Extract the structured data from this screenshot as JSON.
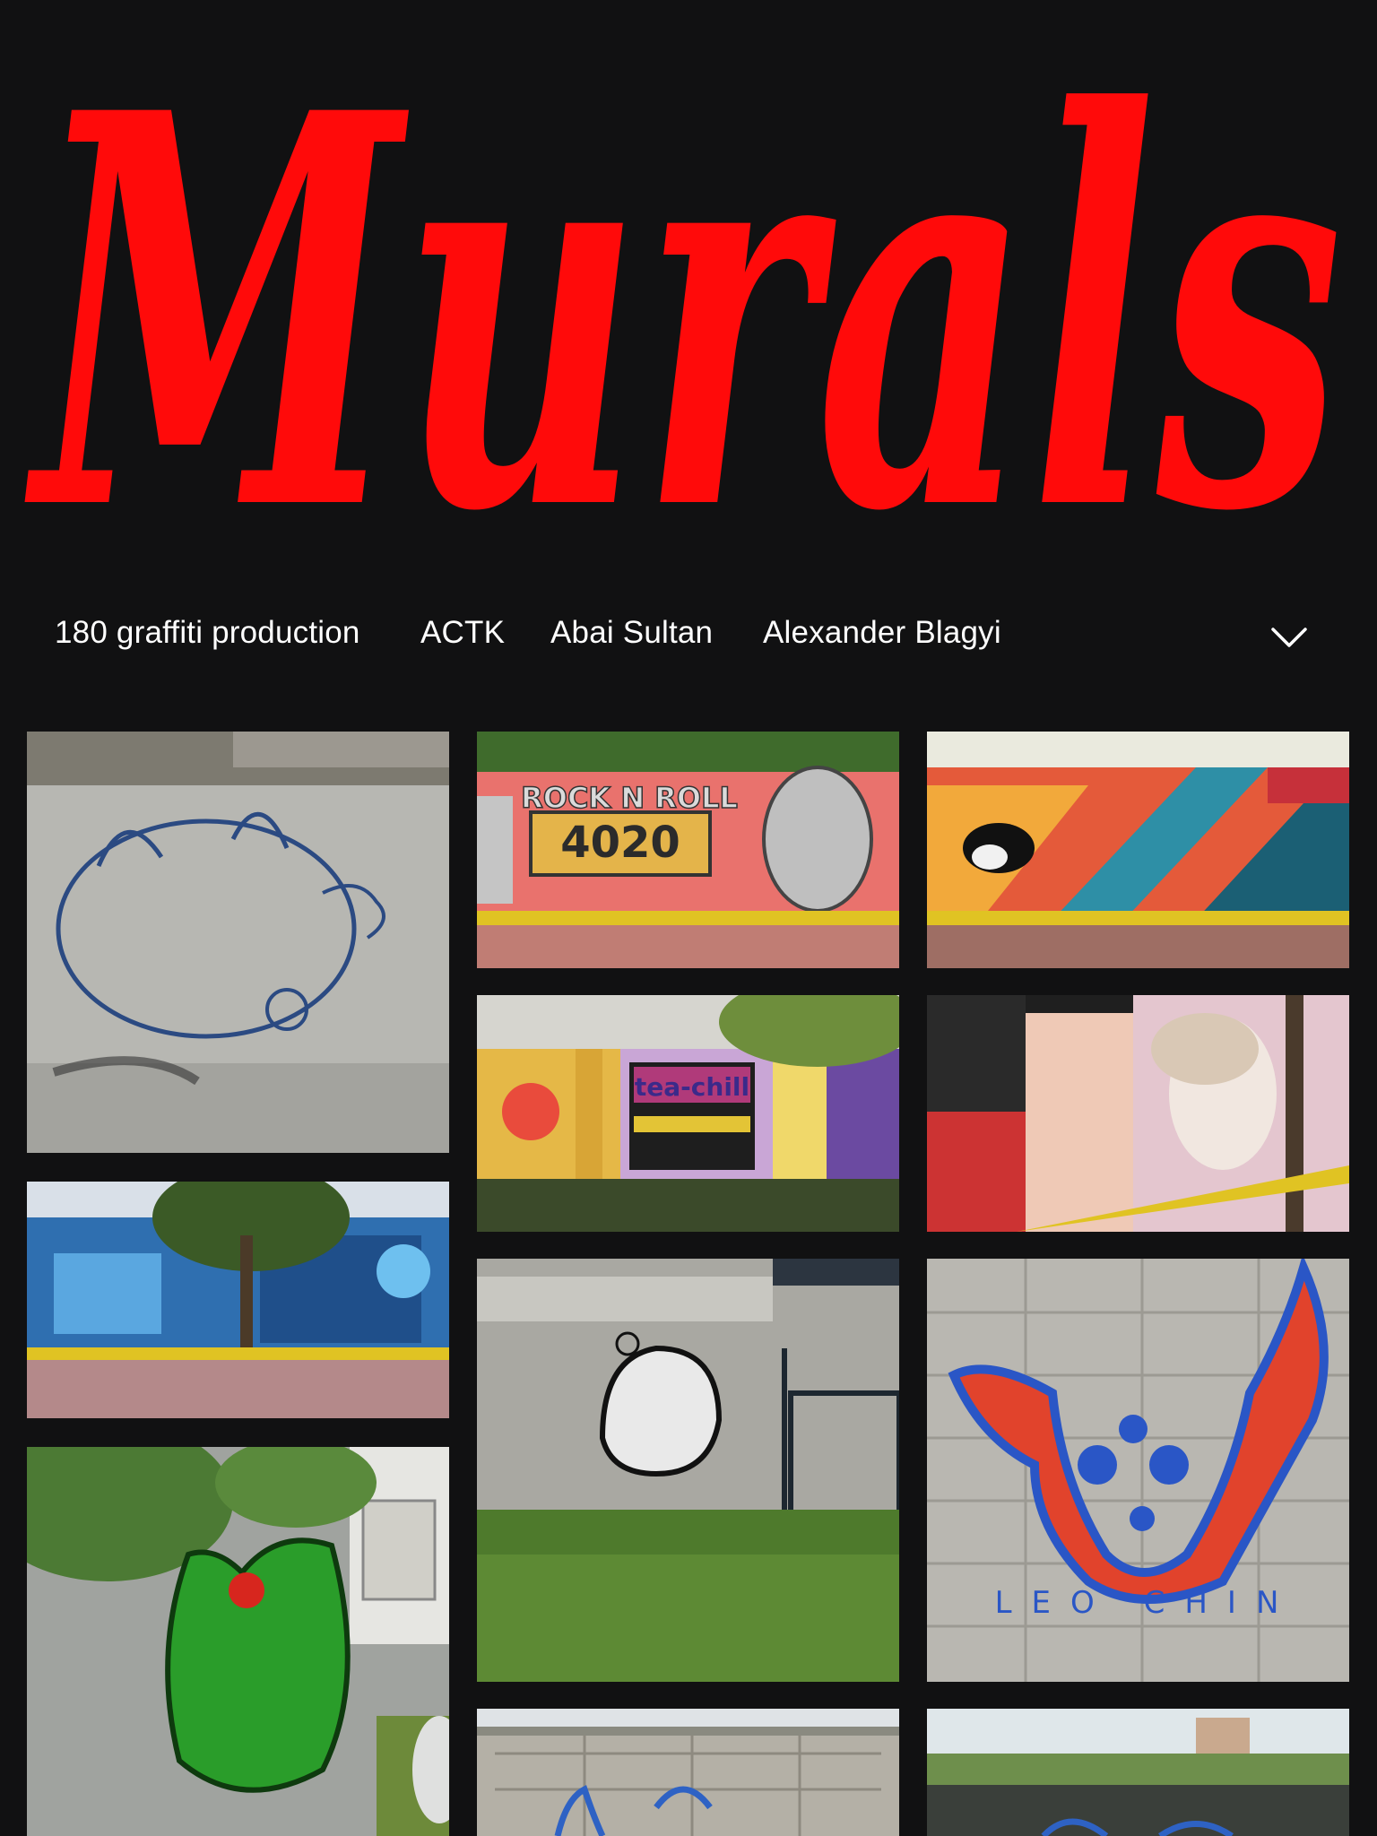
{
  "hero": {
    "title": "Murals",
    "title_color": "#ff0a0a"
  },
  "nav": {
    "items": [
      {
        "label": "180 graffiti production"
      },
      {
        "label": "ACTK"
      },
      {
        "label": "Abai Sultan"
      },
      {
        "label": "Alexander Blagyi"
      }
    ],
    "more_icon": "chevron-down-icon"
  },
  "gallery": {
    "photos": [
      {
        "subject": "blue outline character on grey concrete wall"
      },
      {
        "subject": "rock n roll graffiti wall with robot guitarist"
      },
      {
        "subject": "magpie bird mural with diagonal stripes"
      },
      {
        "subject": "colorful mural panels behind railing"
      },
      {
        "subject": "classical statue face mural"
      },
      {
        "subject": "blue characters mural with tree"
      },
      {
        "subject": "small black and white character on concrete"
      },
      {
        "subject": "red three-eyed dog head on cinder blocks"
      },
      {
        "subject": "green dragon character on wall"
      },
      {
        "subject": "blue graffiti on block wall"
      },
      {
        "subject": "graffiti wall behind fence with city"
      }
    ],
    "tile_texts": {
      "rock_roll": "ROCK N ROLL",
      "year": "4020",
      "tea": "tea-chill",
      "artist": "LEO CHIN"
    }
  }
}
